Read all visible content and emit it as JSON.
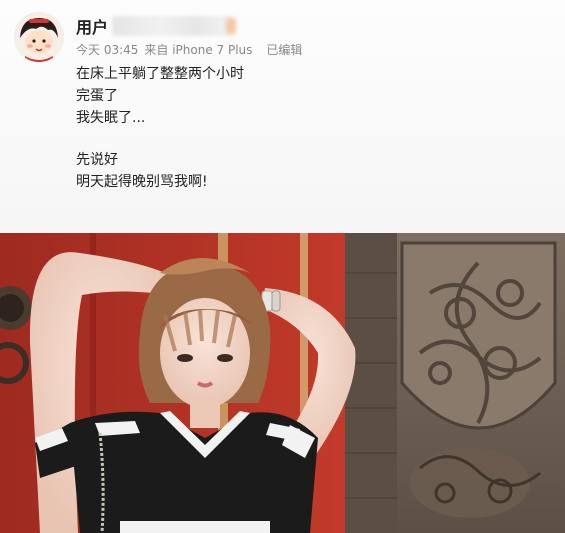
{
  "post": {
    "username": "用户",
    "time": "今天 03:45",
    "source": "来自 iPhone 7 Plus",
    "edited": "已编辑",
    "lines_1": [
      "在床上平躺了整整两个小时",
      "完蛋了",
      "我失眠了..."
    ],
    "lines_2": [
      "先说好",
      "明天起得晚别骂我啊!"
    ]
  },
  "colors": {
    "wall_red": "#b53226",
    "dress_black": "#1b1b1b",
    "stone": "#6f6152"
  }
}
